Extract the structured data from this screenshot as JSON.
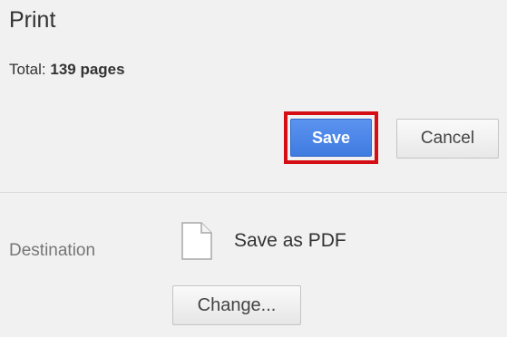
{
  "header": {
    "title": "Print",
    "total_label": "Total:",
    "total_count": "139 pages"
  },
  "actions": {
    "save_label": "Save",
    "cancel_label": "Cancel"
  },
  "destination": {
    "label": "Destination",
    "icon": "document-icon",
    "name": "Save as PDF",
    "change_label": "Change..."
  },
  "colors": {
    "primary_button": "#4285f4",
    "highlight_border": "#d40e14",
    "panel_background": "#f1f1f1"
  }
}
